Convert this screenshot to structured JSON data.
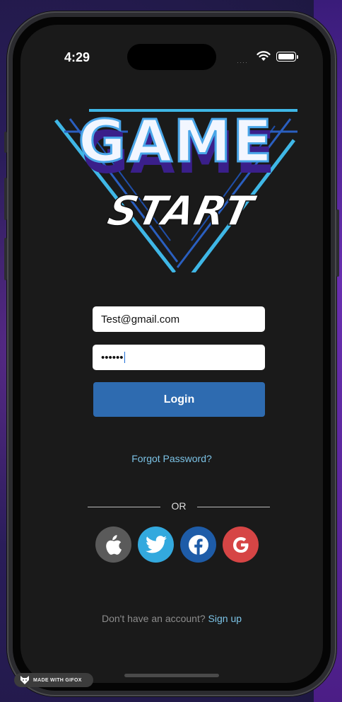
{
  "status_bar": {
    "time": "4:29",
    "signal": "····"
  },
  "logo": {
    "line1": "GAME",
    "line2": "START"
  },
  "form": {
    "email_value": "Test@gmail.com",
    "password_value": "••••••",
    "login_label": "Login",
    "forgot_label": "Forgot Password?"
  },
  "divider": {
    "or_label": "OR"
  },
  "social": [
    {
      "name": "apple",
      "icon": "apple-icon",
      "color": "#5a5a5a"
    },
    {
      "name": "twitter",
      "icon": "twitter-icon",
      "color": "#33a9de"
    },
    {
      "name": "facebook",
      "icon": "facebook-icon",
      "color": "#1e5ca8"
    },
    {
      "name": "google",
      "icon": "google-icon",
      "color": "#d64545"
    }
  ],
  "signup": {
    "prompt": "Don't have an account?",
    "link": "Sign up"
  },
  "watermark": {
    "label": "MADE WITH GIFOX"
  },
  "colors": {
    "accent_blue": "#2e6bb0",
    "link": "#7cc3e6",
    "screen_bg": "#1a1a1a"
  }
}
